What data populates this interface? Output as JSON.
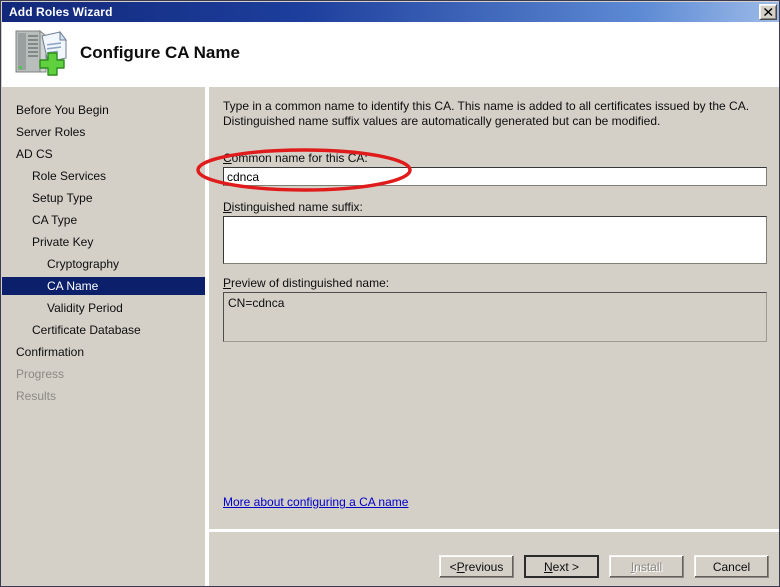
{
  "window": {
    "title": "Add Roles Wizard",
    "close_label": "Close",
    "close_icon": "close-x-icon"
  },
  "header": {
    "title": "Configure CA Name",
    "icon": "server-with-certificate-add-icon"
  },
  "sidebar": {
    "items": [
      {
        "label": "Before You Begin",
        "level": 0,
        "state": "normal"
      },
      {
        "label": "Server Roles",
        "level": 0,
        "state": "normal"
      },
      {
        "label": "AD CS",
        "level": 0,
        "state": "normal"
      },
      {
        "label": "Role Services",
        "level": 1,
        "state": "normal"
      },
      {
        "label": "Setup Type",
        "level": 1,
        "state": "normal"
      },
      {
        "label": "CA Type",
        "level": 1,
        "state": "normal"
      },
      {
        "label": "Private Key",
        "level": 1,
        "state": "normal"
      },
      {
        "label": "Cryptography",
        "level": 2,
        "state": "normal"
      },
      {
        "label": "CA Name",
        "level": 2,
        "state": "selected"
      },
      {
        "label": "Validity Period",
        "level": 2,
        "state": "normal"
      },
      {
        "label": "Certificate Database",
        "level": 1,
        "state": "normal"
      },
      {
        "label": "Confirmation",
        "level": 0,
        "state": "normal"
      },
      {
        "label": "Progress",
        "level": 0,
        "state": "disabled"
      },
      {
        "label": "Results",
        "level": 0,
        "state": "disabled"
      }
    ]
  },
  "main": {
    "intro_line1": "Type in a common name to identify this CA. This name is added to all certificates issued by the CA.",
    "intro_line2": "Distinguished name suffix values are automatically generated but can be modified.",
    "common_name_label_accel": "C",
    "common_name_label_rest": "ommon name for this CA:",
    "common_name_value": "cdnca",
    "common_name_placeholder": "",
    "dn_suffix_label_accel": "D",
    "dn_suffix_label_rest": "istinguished name suffix:",
    "dn_suffix_value": "",
    "dn_suffix_placeholder": "",
    "preview_label_accel": "P",
    "preview_label_rest": "review of distinguished name:",
    "preview_value": "CN=cdnca",
    "help_link": "More about configuring a CA name"
  },
  "footer": {
    "previous_prefix": "< ",
    "previous_accel": "P",
    "previous_rest": "revious",
    "next_accel": "N",
    "next_rest": "ext >",
    "install_accel": "I",
    "install_rest": "nstall",
    "cancel_label": "Cancel"
  },
  "annotation": {
    "type": "red-ellipse-highlight",
    "color": "#e01b1b",
    "target": "common-name-field"
  },
  "colors": {
    "titlebar_start": "#12287a",
    "titlebar_end": "#9dbbe8",
    "dialog_face": "#d4d0c8",
    "selection": "#0c1f6b",
    "link": "#0000c8",
    "annotation_red": "#e01b1b"
  }
}
